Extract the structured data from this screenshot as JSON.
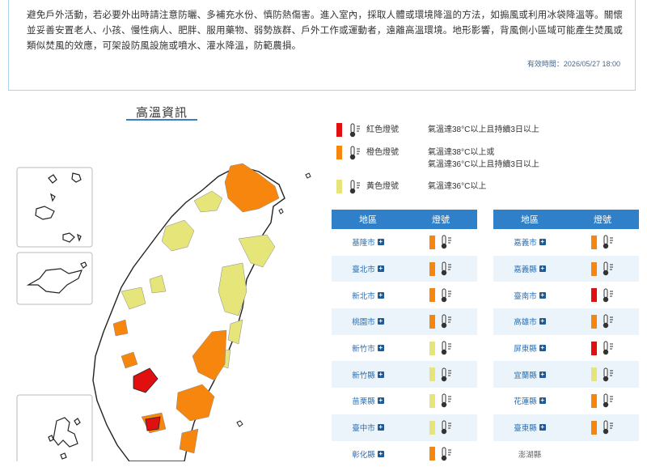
{
  "notice": {
    "line1": "避免戶外活動，若必要外出時請注意防曬、多補充水份、慎防熱傷害。進入室內，採取人體或環境降溫的方法，如搧風或利用冰袋降溫等。關懷",
    "line2": "並妥善安置老人、小孩、慢性病人、肥胖、服用藥物、弱勢族群、戶外工作或運動者，遠離高溫環境。地形影響，背風側小區域可能產生焚風或",
    "line3": "類似焚風的效應，可架設防風設施或噴水、灌水降溫，防範農損。",
    "valid_time": "有效時間：2026/05/27 18:00"
  },
  "section_title": "高溫資訊",
  "colors": {
    "red": "#e01010",
    "orange": "#f7860f",
    "yellow": "#e5e57a",
    "header_blue": "#2f80c8"
  },
  "legend": [
    {
      "label": "紅色燈號",
      "desc1": "氣溫達38°C以上且持續3日以上",
      "desc2": "",
      "color": "#e01010",
      "icon": "thermometer-icon"
    },
    {
      "label": "橙色燈號",
      "desc1": "氣溫達38°C以上或",
      "desc2": "氣溫達36°C以上且持續3日以上",
      "color": "#f7860f",
      "icon": "thermometer-icon"
    },
    {
      "label": "黃色燈號",
      "desc1": "氣溫達36°C以上",
      "desc2": "",
      "color": "#e5e57a",
      "icon": "thermometer-icon"
    }
  ],
  "table_headers": {
    "region": "地區",
    "signal": "燈號"
  },
  "left_table": [
    {
      "name": "基隆市",
      "signal": "orange"
    },
    {
      "name": "臺北市",
      "signal": "orange"
    },
    {
      "name": "新北市",
      "signal": "orange"
    },
    {
      "name": "桃園市",
      "signal": "orange"
    },
    {
      "name": "新竹市",
      "signal": "yellow"
    },
    {
      "name": "新竹縣",
      "signal": "yellow"
    },
    {
      "name": "苗栗縣",
      "signal": "yellow"
    },
    {
      "name": "臺中市",
      "signal": "yellow"
    },
    {
      "name": "彰化縣",
      "signal": "orange"
    }
  ],
  "right_table": [
    {
      "name": "嘉義市",
      "signal": "orange"
    },
    {
      "name": "嘉義縣",
      "signal": "orange"
    },
    {
      "name": "臺南市",
      "signal": "red"
    },
    {
      "name": "高雄市",
      "signal": "orange"
    },
    {
      "name": "屏東縣",
      "signal": "red"
    },
    {
      "name": "宜蘭縣",
      "signal": "yellow"
    },
    {
      "name": "花蓮縣",
      "signal": "orange"
    },
    {
      "name": "臺東縣",
      "signal": "orange"
    },
    {
      "name": "澎湖縣",
      "signal": "none"
    }
  ]
}
